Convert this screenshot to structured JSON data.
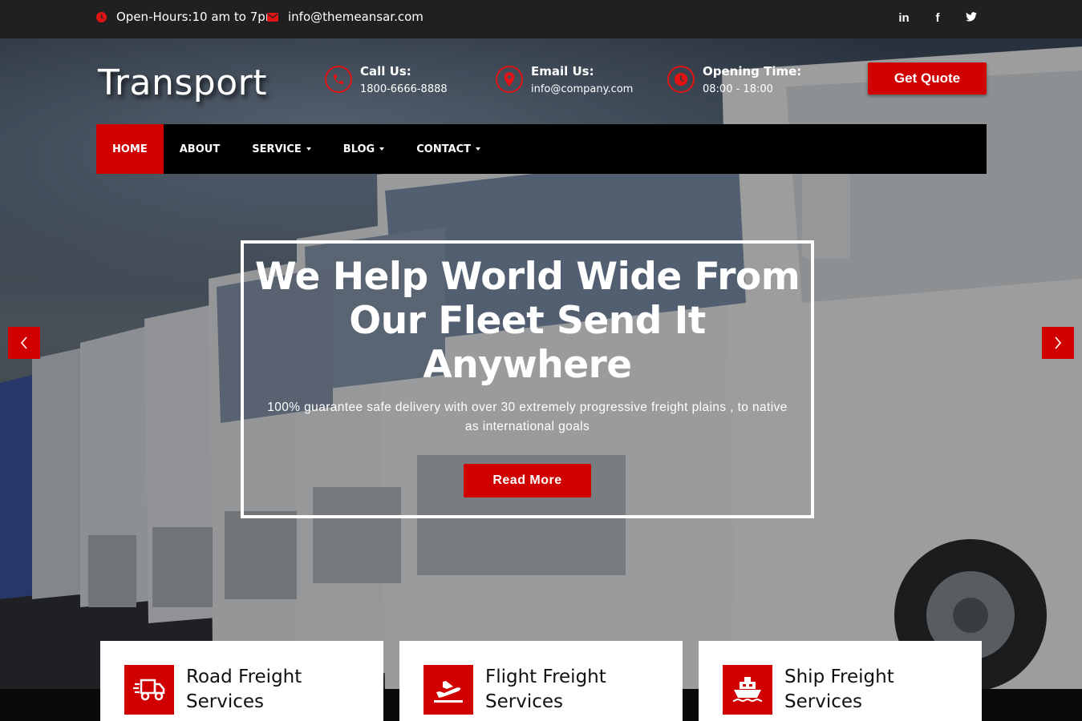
{
  "topbar": {
    "hours": "Open-Hours:10 am to 7pm",
    "email": "info@themeansar.com",
    "social": [
      {
        "icon": "linkedin-icon",
        "glyph": "in"
      },
      {
        "icon": "facebook-icon",
        "glyph": "f"
      },
      {
        "icon": "twitter-icon",
        "glyph": "t"
      }
    ]
  },
  "header": {
    "logo": "Transport",
    "contacts": [
      {
        "icon": "phone-icon",
        "title": "Call Us:",
        "value": "1800-6666-8888"
      },
      {
        "icon": "map-pin-icon",
        "title": "Email Us:",
        "value": "info@company.com"
      },
      {
        "icon": "clock-icon",
        "title": "Opening Time:",
        "value": "08:00 - 18:00"
      }
    ],
    "quote_label": "Get Quote"
  },
  "nav": {
    "items": [
      {
        "label": "HOME",
        "active": true,
        "dropdown": false
      },
      {
        "label": "ABOUT",
        "active": false,
        "dropdown": false
      },
      {
        "label": "SERVICE",
        "active": false,
        "dropdown": true
      },
      {
        "label": "BLOG",
        "active": false,
        "dropdown": true
      },
      {
        "label": "CONTACT",
        "active": false,
        "dropdown": true
      }
    ]
  },
  "slide": {
    "heading": "We Help World Wide From Our Fleet Send It Anywhere",
    "text": "100% guarantee safe delivery with over 30 extremely progressive freight plains , to native as international goals",
    "button": "Read More"
  },
  "services": [
    {
      "icon": "truck-icon",
      "line1": "Road Freight",
      "line2": "Services"
    },
    {
      "icon": "airplane-icon",
      "line1": "Flight Freight",
      "line2": "Services"
    },
    {
      "icon": "ship-icon",
      "line1": "Ship Freight",
      "line2": "Services"
    }
  ],
  "colors": {
    "accent": "#d10000",
    "topbar": "#202020",
    "nav": "#000000"
  }
}
